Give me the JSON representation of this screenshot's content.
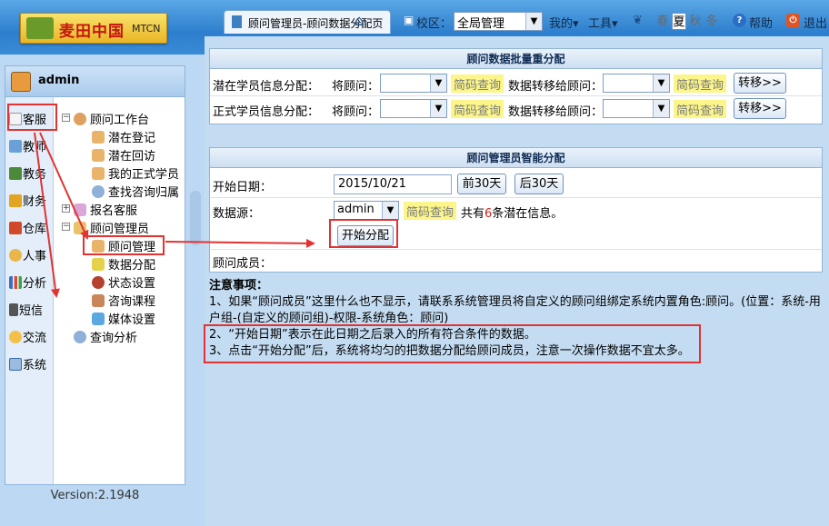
{
  "header": {
    "logo_text": "麦田中国",
    "logo_suffix": "MTCN",
    "tab_title": "顾问管理员-顾问数据分配页",
    "campus_label": "校区：",
    "campus_value": "全局管理",
    "my_menu": "我的",
    "tools_menu": "工具",
    "seasons": [
      "春",
      "夏",
      "秋",
      "冬"
    ],
    "active_season": "夏",
    "help": "帮助",
    "logout": "退出"
  },
  "sidebar": {
    "username": "admin",
    "categories": [
      "客服",
      "教师",
      "教务",
      "财务",
      "仓库",
      "人事",
      "分析",
      "短信",
      "交流",
      "系统"
    ],
    "active_category": "客服",
    "tree": {
      "workbench": "顾问工作台",
      "workbench_items": [
        "潜在登记",
        "潜在回访",
        "我的正式学员",
        "查找咨询归属"
      ],
      "signup": "报名客服",
      "admin": "顾问管理员",
      "admin_items": [
        "顾问管理",
        "数据分配",
        "状态设置",
        "咨询课程",
        "媒体设置"
      ],
      "analysis": "查询分析"
    },
    "version": "Version:2.1948"
  },
  "batch": {
    "title": "顾问数据批量重分配",
    "rows": [
      {
        "label": "潜在学员信息分配：",
        "from_label": "将顾问：",
        "search": "简码查询",
        "to_label": "数据转移给顾问：",
        "search2": "简码查询",
        "button": "转移>>"
      },
      {
        "label": "正式学员信息分配：",
        "from_label": "将顾问：",
        "search": "简码查询",
        "to_label": "数据转移给顾问：",
        "search2": "简码查询",
        "button": "转移>>"
      }
    ]
  },
  "smart": {
    "title": "顾问管理员智能分配",
    "start_date_label": "开始日期：",
    "start_date": "2015/10/21",
    "prev_btn": "前30天",
    "next_btn": "后30天",
    "source_label": "数据源：",
    "source_value": "admin",
    "search": "简码查询",
    "count_prefix": "共有",
    "count": "6",
    "count_suffix": "条潜在信息。",
    "start_btn": "开始分配",
    "members_label": "顾问成员："
  },
  "notes": {
    "title": "注意事项：",
    "line1": "1、如果“顾问成员”这里什么也不显示，请联系系统管理员将自定义的顾问组绑定系统内置角色:顾问。(位置：系统-用户组-(自定义的顾问组)-权限-系统角色：顾问)",
    "line2": "2、“开始日期”表示在此日期之后录入的所有符合条件的数据。",
    "line3": "3、点击“开始分配”后，系统将均匀的把数据分配给顾问成员，注意一次操作数据不宜太多。"
  },
  "colors": {
    "highlight_red": "#e23232",
    "count_red": "#d81e1e",
    "search_yellow": "#fbf58a"
  }
}
